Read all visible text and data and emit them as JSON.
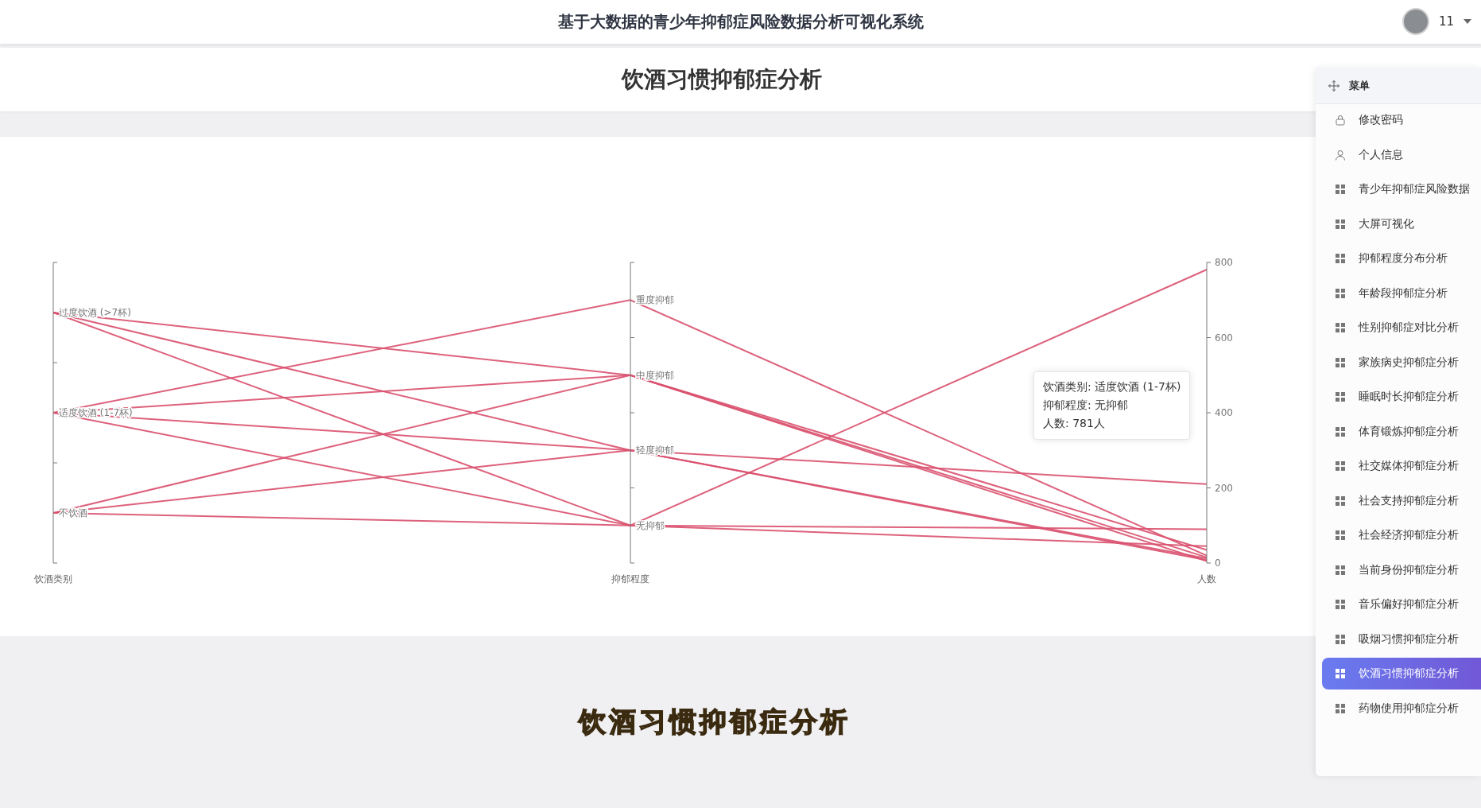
{
  "header": {
    "title": "基于大数据的青少年抑郁症风险数据分析可视化系统",
    "user": "11"
  },
  "page_title": "饮酒习惯抑郁症分析",
  "chart": {
    "axes": [
      {
        "kind": "category",
        "title": "饮酒类别",
        "labels": [
          "过度饮酒 (>7杯)",
          "适度饮酒 (1-7杯)",
          "不饮酒"
        ]
      },
      {
        "kind": "category",
        "title": "抑郁程度",
        "labels": [
          "重度抑郁",
          "中度抑郁",
          "轻度抑郁",
          "无抑郁"
        ]
      },
      {
        "kind": "value",
        "title": "人数",
        "labels": [
          "800",
          "600",
          "400",
          "200",
          "0"
        ]
      }
    ],
    "tooltip": [
      "饮酒类别: 适度饮酒 (1-7杯)",
      "抑郁程度: 无抑郁",
      "人数: 781人"
    ]
  },
  "caption": "饮酒习惯抑郁症分析",
  "menu": {
    "title": "菜单",
    "items": [
      {
        "label": "修改密码",
        "kind": "lock",
        "selected": false
      },
      {
        "label": "个人信息",
        "kind": "user",
        "selected": false
      },
      {
        "label": "青少年抑郁症风险数据",
        "kind": "grid",
        "selected": false
      },
      {
        "label": "大屏可视化",
        "kind": "grid",
        "selected": false
      },
      {
        "label": "抑郁程度分布分析",
        "kind": "grid",
        "selected": false
      },
      {
        "label": "年龄段抑郁症分析",
        "kind": "grid",
        "selected": false
      },
      {
        "label": "性别抑郁症对比分析",
        "kind": "grid",
        "selected": false
      },
      {
        "label": "家族病史抑郁症分析",
        "kind": "grid",
        "selected": false
      },
      {
        "label": "睡眠时长抑郁症分析",
        "kind": "grid",
        "selected": false
      },
      {
        "label": "体育锻炼抑郁症分析",
        "kind": "grid",
        "selected": false
      },
      {
        "label": "社交媒体抑郁症分析",
        "kind": "grid",
        "selected": false
      },
      {
        "label": "社会支持抑郁症分析",
        "kind": "grid",
        "selected": false
      },
      {
        "label": "社会经济抑郁症分析",
        "kind": "grid",
        "selected": false
      },
      {
        "label": "当前身份抑郁症分析",
        "kind": "grid",
        "selected": false
      },
      {
        "label": "音乐偏好抑郁症分析",
        "kind": "grid",
        "selected": false
      },
      {
        "label": "吸烟习惯抑郁症分析",
        "kind": "grid",
        "selected": false
      },
      {
        "label": "饮酒习惯抑郁症分析",
        "kind": "grid",
        "selected": true
      },
      {
        "label": "药物使用抑郁症分析",
        "kind": "grid",
        "selected": false
      }
    ]
  }
}
